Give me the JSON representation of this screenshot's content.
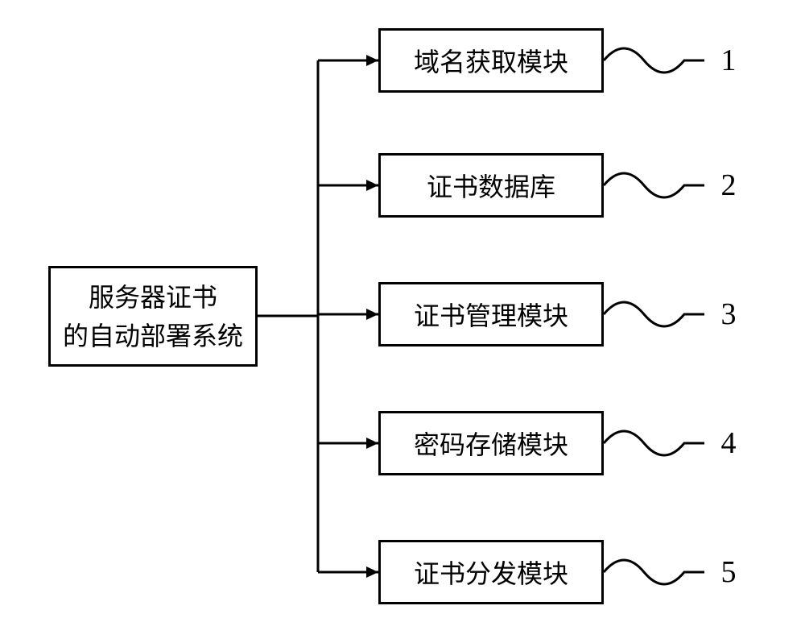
{
  "root": {
    "line1": "服务器证书",
    "line2": "的自动部署系统"
  },
  "modules": [
    {
      "label": "域名获取模块",
      "num": "1"
    },
    {
      "label": "证书数据库",
      "num": "2"
    },
    {
      "label": "证书管理模块",
      "num": "3"
    },
    {
      "label": "密码存储模块",
      "num": "4"
    },
    {
      "label": "证书分发模块",
      "num": "5"
    }
  ]
}
